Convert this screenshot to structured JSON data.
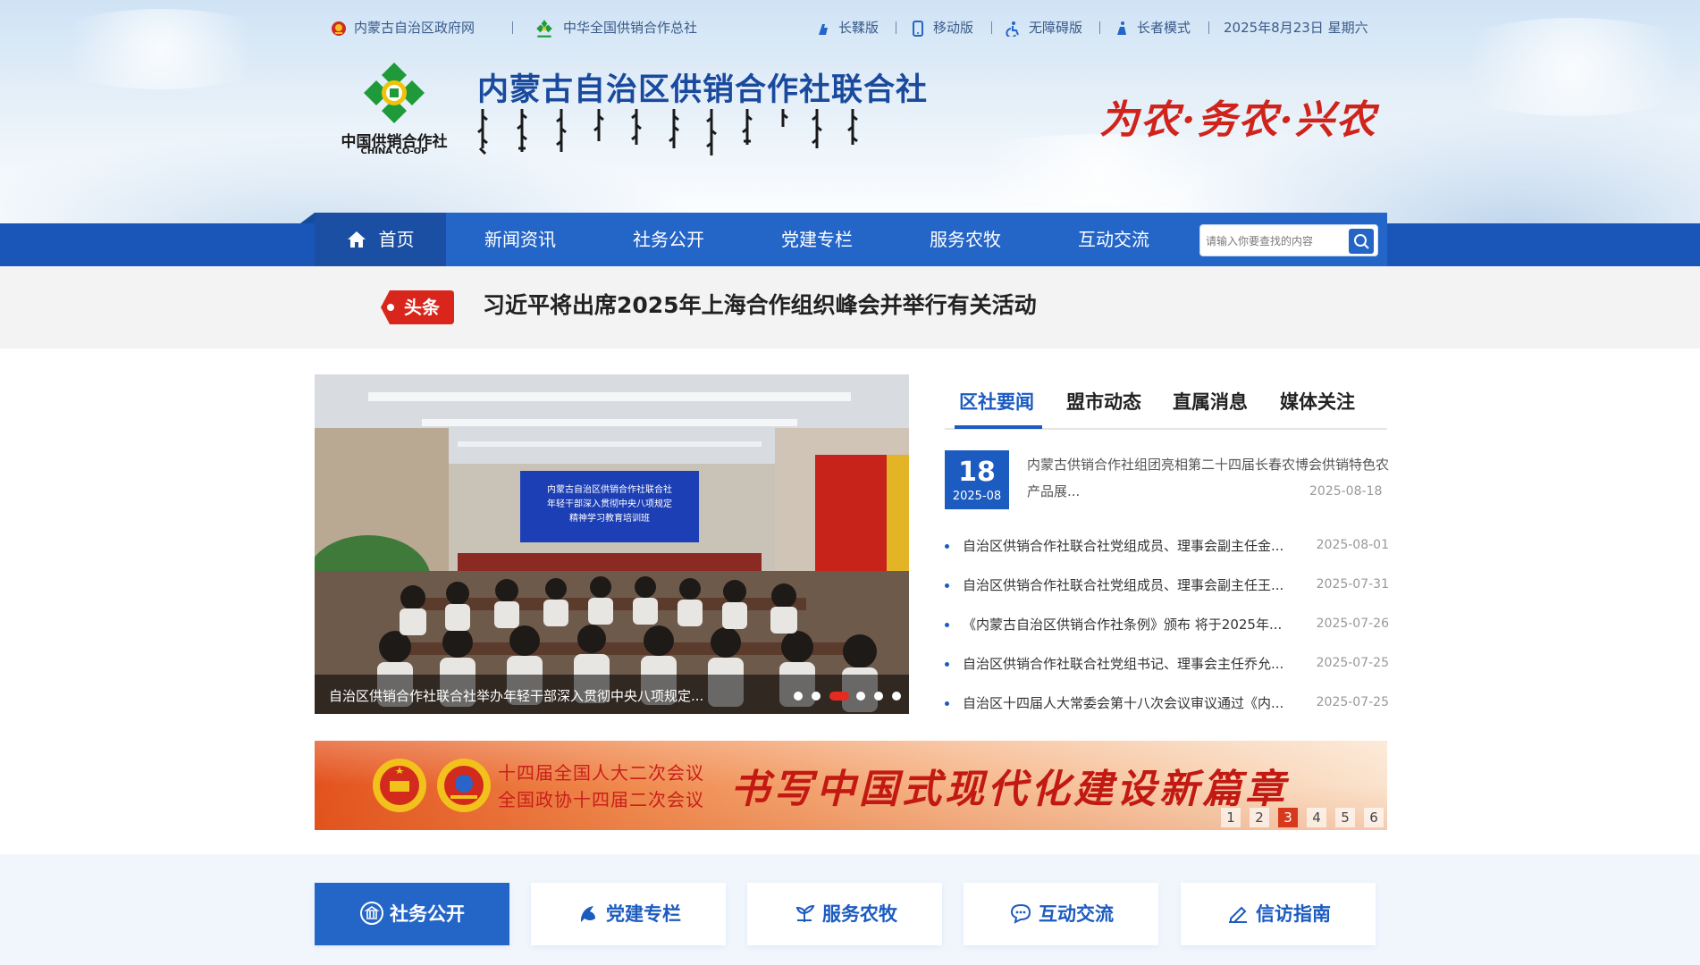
{
  "topbar": {
    "gov_link": "内蒙古自治区政府网",
    "coop_link": "中华全国供销合作总社",
    "mongol_version": "长鞣版",
    "mobile_version": "移动版",
    "accessible_version": "无障碍版",
    "elder_mode": "长者模式",
    "date": "2025年8月23日 星期六"
  },
  "logo": {
    "text_cn": "中国供销合作社",
    "text_en": "CHINA CO-OP",
    "green": "#1f9a3a",
    "yellow": "#f0c20a"
  },
  "site": {
    "title": "内蒙古自治区供销合作社联合社",
    "slogan": "为农·务农·兴农",
    "slogan_color": "#d0231b",
    "title_color": "#1a4a9e"
  },
  "nav": {
    "home": "首页",
    "items": [
      "新闻资讯",
      "社务公开",
      "党建专栏",
      "服务农牧",
      "互动交流"
    ],
    "search_placeholder": "请输入你要查找的内容",
    "color": "#2465c8"
  },
  "headline": {
    "tag": "头条",
    "text": "习近平将出席2025年上海合作组织峰会并举行有关活动"
  },
  "carousel": {
    "caption": "自治区供销合作社联合社举办年轻干部深入贯彻中央八项规定...",
    "screen_text": "内蒙古自治区供销合作社联合社年轻干部深入贯彻中央八项规定精神学习教育培训班",
    "dots": 6,
    "active_dot": 3
  },
  "news": {
    "tabs": [
      "区社要闻",
      "盟市动态",
      "直属消息",
      "媒体关注"
    ],
    "active_tab": 0,
    "featured": {
      "day": "18",
      "year_month": "2025-08",
      "title": "内蒙古供销合作社组团亮相第二十四届长春农博会供销特色农产品展...",
      "date": "2025-08-18"
    },
    "items": [
      {
        "title": "自治区供销合作社联合社党组成员、理事会副主任金...",
        "date": "2025-08-01"
      },
      {
        "title": "自治区供销合作社联合社党组成员、理事会副主任王...",
        "date": "2025-07-31"
      },
      {
        "title": "《内蒙古自治区供销合作社条例》颁布 将于2025年...",
        "date": "2025-07-26"
      },
      {
        "title": "自治区供销合作社联合社党组书记、理事会主任乔允...",
        "date": "2025-07-25"
      },
      {
        "title": "自治区十四届人大常委会第十八次会议审议通过《内...",
        "date": "2025-07-25"
      }
    ]
  },
  "banner": {
    "line1": "十四届全国人大二次会议",
    "line2": "全国政协十四届二次会议",
    "slogan": "书写中国式现代化建设新篇章",
    "pages": [
      "1",
      "2",
      "3",
      "4",
      "5",
      "6"
    ],
    "active_page": 2
  },
  "quick_links": {
    "items": [
      {
        "label": "社务公开",
        "icon": "building-icon"
      },
      {
        "label": "党建专栏",
        "icon": "party-emblem-icon"
      },
      {
        "label": "服务农牧",
        "icon": "sprout-icon"
      },
      {
        "label": "互动交流",
        "icon": "chat-icon"
      },
      {
        "label": "信访指南",
        "icon": "pen-icon"
      }
    ],
    "active_index": 0
  }
}
